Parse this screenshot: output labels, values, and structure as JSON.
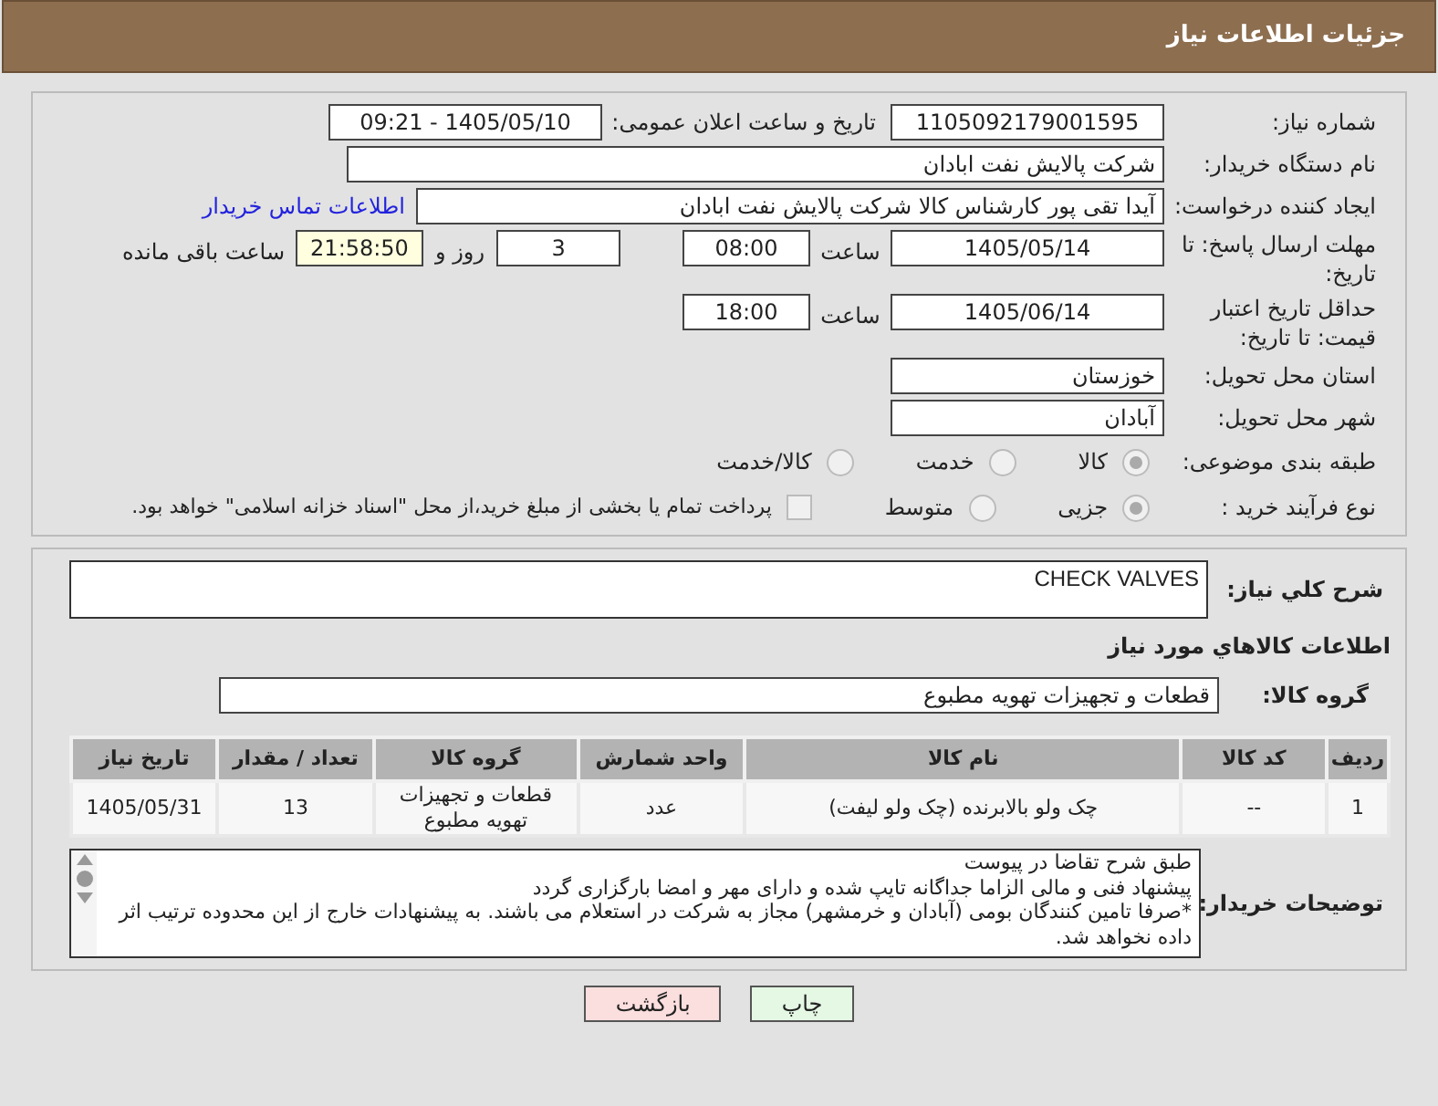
{
  "header": {
    "title": "جزئیات اطلاعات نیاز"
  },
  "need_number": {
    "label": "شماره نیاز:",
    "value": "1105092179001595"
  },
  "announce": {
    "label": "تاریخ و ساعت اعلان عمومی:",
    "value": "1405/05/10 - 09:21"
  },
  "buyer": {
    "label": "نام دستگاه خریدار:",
    "value": "شرکت پالایش نفت ابادان"
  },
  "creator": {
    "label": "ایجاد کننده درخواست:",
    "value": "آیدا تقی پور کارشناس کالا شرکت پالایش نفت ابادان",
    "link": "اطلاعات تماس خریدار"
  },
  "deadline": {
    "label": "مهلت ارسال پاسخ: تا تاریخ:",
    "date": "1405/05/14",
    "time_label": "ساعت",
    "time": "08:00",
    "days": "3",
    "days_label": "روز و",
    "remaining": "21:58:50",
    "remaining_label": "ساعت باقی مانده"
  },
  "validity": {
    "label": "حداقل تاریخ اعتبار قیمت: تا تاریخ:",
    "date": "1405/06/14",
    "time_label": "ساعت",
    "time": "18:00"
  },
  "province": {
    "label": "استان محل تحویل:",
    "value": "خوزستان"
  },
  "city": {
    "label": "شهر محل تحویل:",
    "value": "آبادان"
  },
  "category": {
    "label": "طبقه بندی موضوعی:",
    "options": [
      {
        "label": "کالا",
        "selected": true
      },
      {
        "label": "خدمت",
        "selected": false
      },
      {
        "label": "کالا/خدمت",
        "selected": false
      }
    ]
  },
  "process": {
    "label": "نوع فرآیند خرید :",
    "options": [
      {
        "label": "جزیی",
        "selected": true
      },
      {
        "label": "متوسط",
        "selected": false
      }
    ],
    "payment": {
      "label": "پرداخت تمام یا بخشی از مبلغ خرید،از محل \"اسناد خزانه اسلامی\" خواهد بود.",
      "checked": false
    }
  },
  "description": {
    "label": "شرح کلي نياز:",
    "value": "CHECK VALVES"
  },
  "goods_title": "اطلاعات کالاهاي مورد نياز",
  "goods_group": {
    "label": "گروه کالا:",
    "value": "قطعات و تجهیزات تهویه مطبوع"
  },
  "table": {
    "columns": [
      "ردیف",
      "کد کالا",
      "نام کالا",
      "واحد شمارش",
      "گروه کالا",
      "تعداد / مقدار",
      "تاریخ نیاز"
    ],
    "rows": [
      [
        "1",
        "--",
        "چک ولو بالابرنده (چک ولو لیفت)",
        "عدد",
        "قطعات و تجهیزات تهویه مطبوع",
        "13",
        "1405/05/31"
      ]
    ]
  },
  "notes": {
    "label": "توضیحات خریدار:",
    "lines": [
      "طبق شرح تقاضا در پیوست",
      "پیشنهاد فنی و مالی الزاما جداگانه تایپ شده و دارای مهر و امضا بارگزاری گردد",
      "*صرفا تامین کنندگان بومی (آبادان و خرمشهر) مجاز به شرکت در استعلام می باشند. به پیشنهادات خارج از این محدوده ترتیب اثر داده نخواهد شد."
    ]
  },
  "buttons": [
    {
      "label": "چاپ",
      "kind": "print"
    },
    {
      "label": "بازگشت",
      "kind": "back"
    }
  ]
}
